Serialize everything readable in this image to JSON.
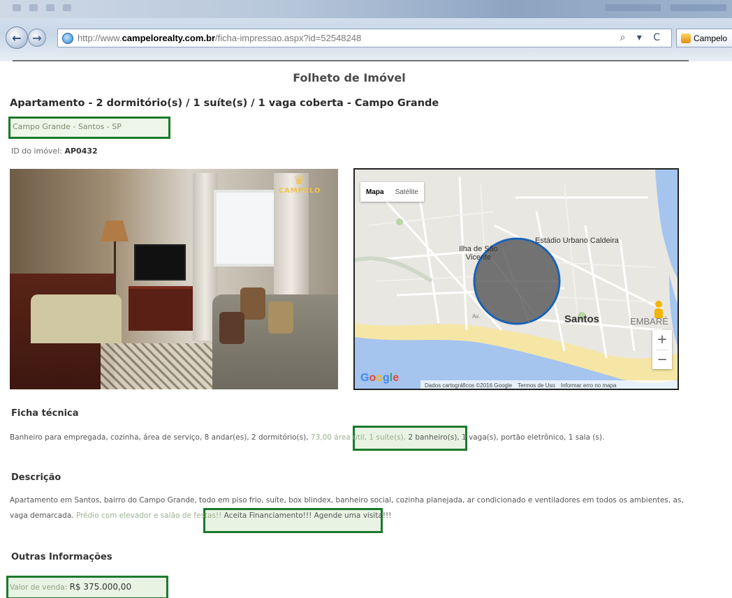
{
  "browser": {
    "url_prefix": "http://www.",
    "url_domain": "campelorealty.com.br",
    "url_path": "/ficha-impressao.aspx?id=52548248",
    "tools": "⌕ ▾ C",
    "tab_label": "Campelo"
  },
  "page": {
    "title": "Folheto de Imóvel",
    "headline": "Apartamento - 2 dormitório(s) / 1 suíte(s) / 1 vaga coberta - Campo Grande",
    "location": "Campo Grande - Santos - SP",
    "id_label": "ID do imóvel:",
    "id_value": "AP0432"
  },
  "photo": {
    "watermark": "CAMPELO"
  },
  "map": {
    "type_map": "Mapa",
    "type_satellite": "Satélite",
    "labels": {
      "ilha": "Ilha de São Vicente",
      "estadio": "Estádio Urbano Caldeira",
      "santos": "Santos",
      "embare": "EMBARÉ",
      "av": "Av."
    },
    "zoom_in": "+",
    "zoom_out": "−",
    "footer_data": "Dados cartográficos ©2016 Google",
    "footer_terms": "Termos de Uso",
    "footer_report": "Informar erro no mapa"
  },
  "ficha": {
    "heading": "Ficha técnica",
    "text_before": "Banheiro para empregada, cozinha, área de serviço, 8 andar(es), 2 dormitório(s),",
    "text_highlight": "73,00 área útil, 1 suíte(s),",
    "text_after": "2 banheiro(s), 1 vaga(s), portão eletrônico, 1 sala (s)."
  },
  "descricao": {
    "heading": "Descrição",
    "text_before": "Apartamento em Santos, bairro do Campo Grande, todo em piso frio, suíte, box blindex, banheiro social, cozinha planejada, ar condicionado e ventiladores em todos os ambientes, as, vaga demarcada.",
    "text_highlight": "Prédio com elevador e salão de festas!!",
    "text_after": "Aceita Financiamento!!! Agende uma visita!!!"
  },
  "outras": {
    "heading": "Outras Informações",
    "price_label": "Valor de venda:",
    "price_value": "R$ 375.000,00"
  }
}
